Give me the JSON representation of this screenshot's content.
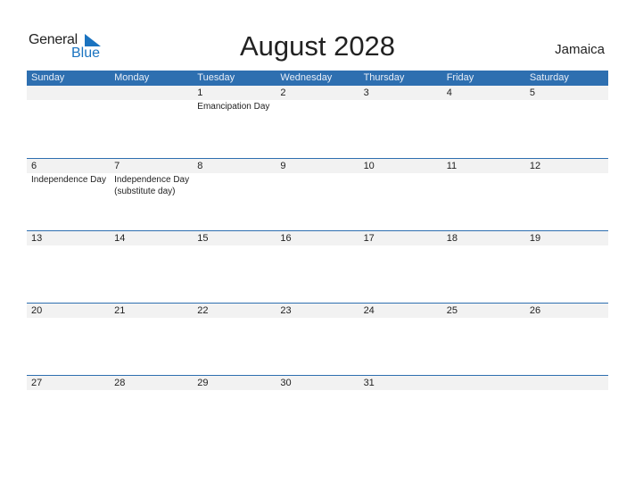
{
  "logo": {
    "general": "General",
    "blue": "Blue"
  },
  "title": "August 2028",
  "country": "Jamaica",
  "weekdays": [
    "Sunday",
    "Monday",
    "Tuesday",
    "Wednesday",
    "Thursday",
    "Friday",
    "Saturday"
  ],
  "weeks": [
    {
      "days": [
        "",
        "",
        "1",
        "2",
        "3",
        "4",
        "5"
      ],
      "events": [
        "",
        "",
        "Emancipation Day",
        "",
        "",
        "",
        ""
      ]
    },
    {
      "days": [
        "6",
        "7",
        "8",
        "9",
        "10",
        "11",
        "12"
      ],
      "events": [
        "Independence Day",
        "Independence Day\n(substitute day)",
        "",
        "",
        "",
        "",
        ""
      ]
    },
    {
      "days": [
        "13",
        "14",
        "15",
        "16",
        "17",
        "18",
        "19"
      ],
      "events": [
        "",
        "",
        "",
        "",
        "",
        "",
        ""
      ]
    },
    {
      "days": [
        "20",
        "21",
        "22",
        "23",
        "24",
        "25",
        "26"
      ],
      "events": [
        "",
        "",
        "",
        "",
        "",
        "",
        ""
      ]
    },
    {
      "days": [
        "27",
        "28",
        "29",
        "30",
        "31",
        "",
        ""
      ],
      "events": [
        "",
        "",
        "",
        "",
        "",
        "",
        ""
      ]
    }
  ]
}
